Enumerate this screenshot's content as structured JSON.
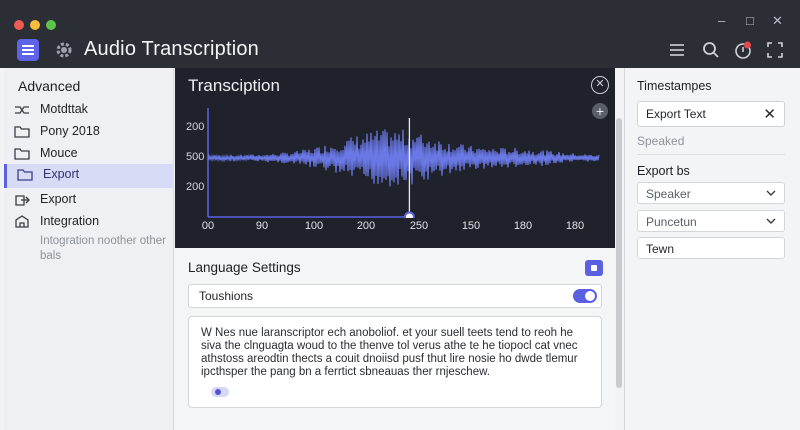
{
  "window": {
    "title": "Audio Transcription",
    "controls": [
      "–",
      "□",
      "✕"
    ]
  },
  "colors": {
    "accent": "#5c62e3",
    "titlebar": "#2b2e35",
    "waveform": "#6f7df0",
    "notification": "#e5484d"
  },
  "toolbar_icons": [
    "list-filter-icon",
    "search-icon",
    "notification-icon",
    "fullscreen-icon"
  ],
  "sidebar": {
    "heading": "Advanced",
    "items": [
      {
        "label": "Motdttak",
        "icon": "shuffle-icon"
      },
      {
        "label": "Pony 2018",
        "icon": "folder-icon"
      },
      {
        "label": "Mouce",
        "icon": "folder-icon"
      },
      {
        "label": "Export",
        "icon": "folder-icon",
        "active": true
      },
      {
        "label": "Export",
        "icon": "export-icon"
      },
      {
        "label": "Integration",
        "icon": "integration-icon"
      }
    ],
    "note": "Intogration noother other bals"
  },
  "waveform": {
    "title": "Transciption",
    "y_ticks": [
      "200",
      "500",
      "200"
    ],
    "x_ticks": [
      "00",
      "90",
      "100",
      "200",
      "250",
      "150",
      "180",
      "180"
    ],
    "playhead_fraction": 0.515
  },
  "settings": {
    "title": "Language Settings",
    "row_label": "Toushions",
    "toggle_on": true,
    "text": "W Nes nue laranscriptor ech anoboliof. et your suell teets tend to reoh he siva the clnguagta woud to the thenve tol verus athe te he tiopocl cat vnec athstoss areodtin thects a couit dnoiisd pusf thut lire nosie ho dwde tlemur ipcthsper the pang bn a ferrtict sbneauas ther rnjeschew."
  },
  "right_panel": {
    "timestamps_label": "Timestampes",
    "export_text": "Export Text",
    "speaked": "Speaked",
    "export_label": "Export bs",
    "speaker": "Speaker",
    "punctuation": "Puncetun",
    "term": "Tewn"
  }
}
